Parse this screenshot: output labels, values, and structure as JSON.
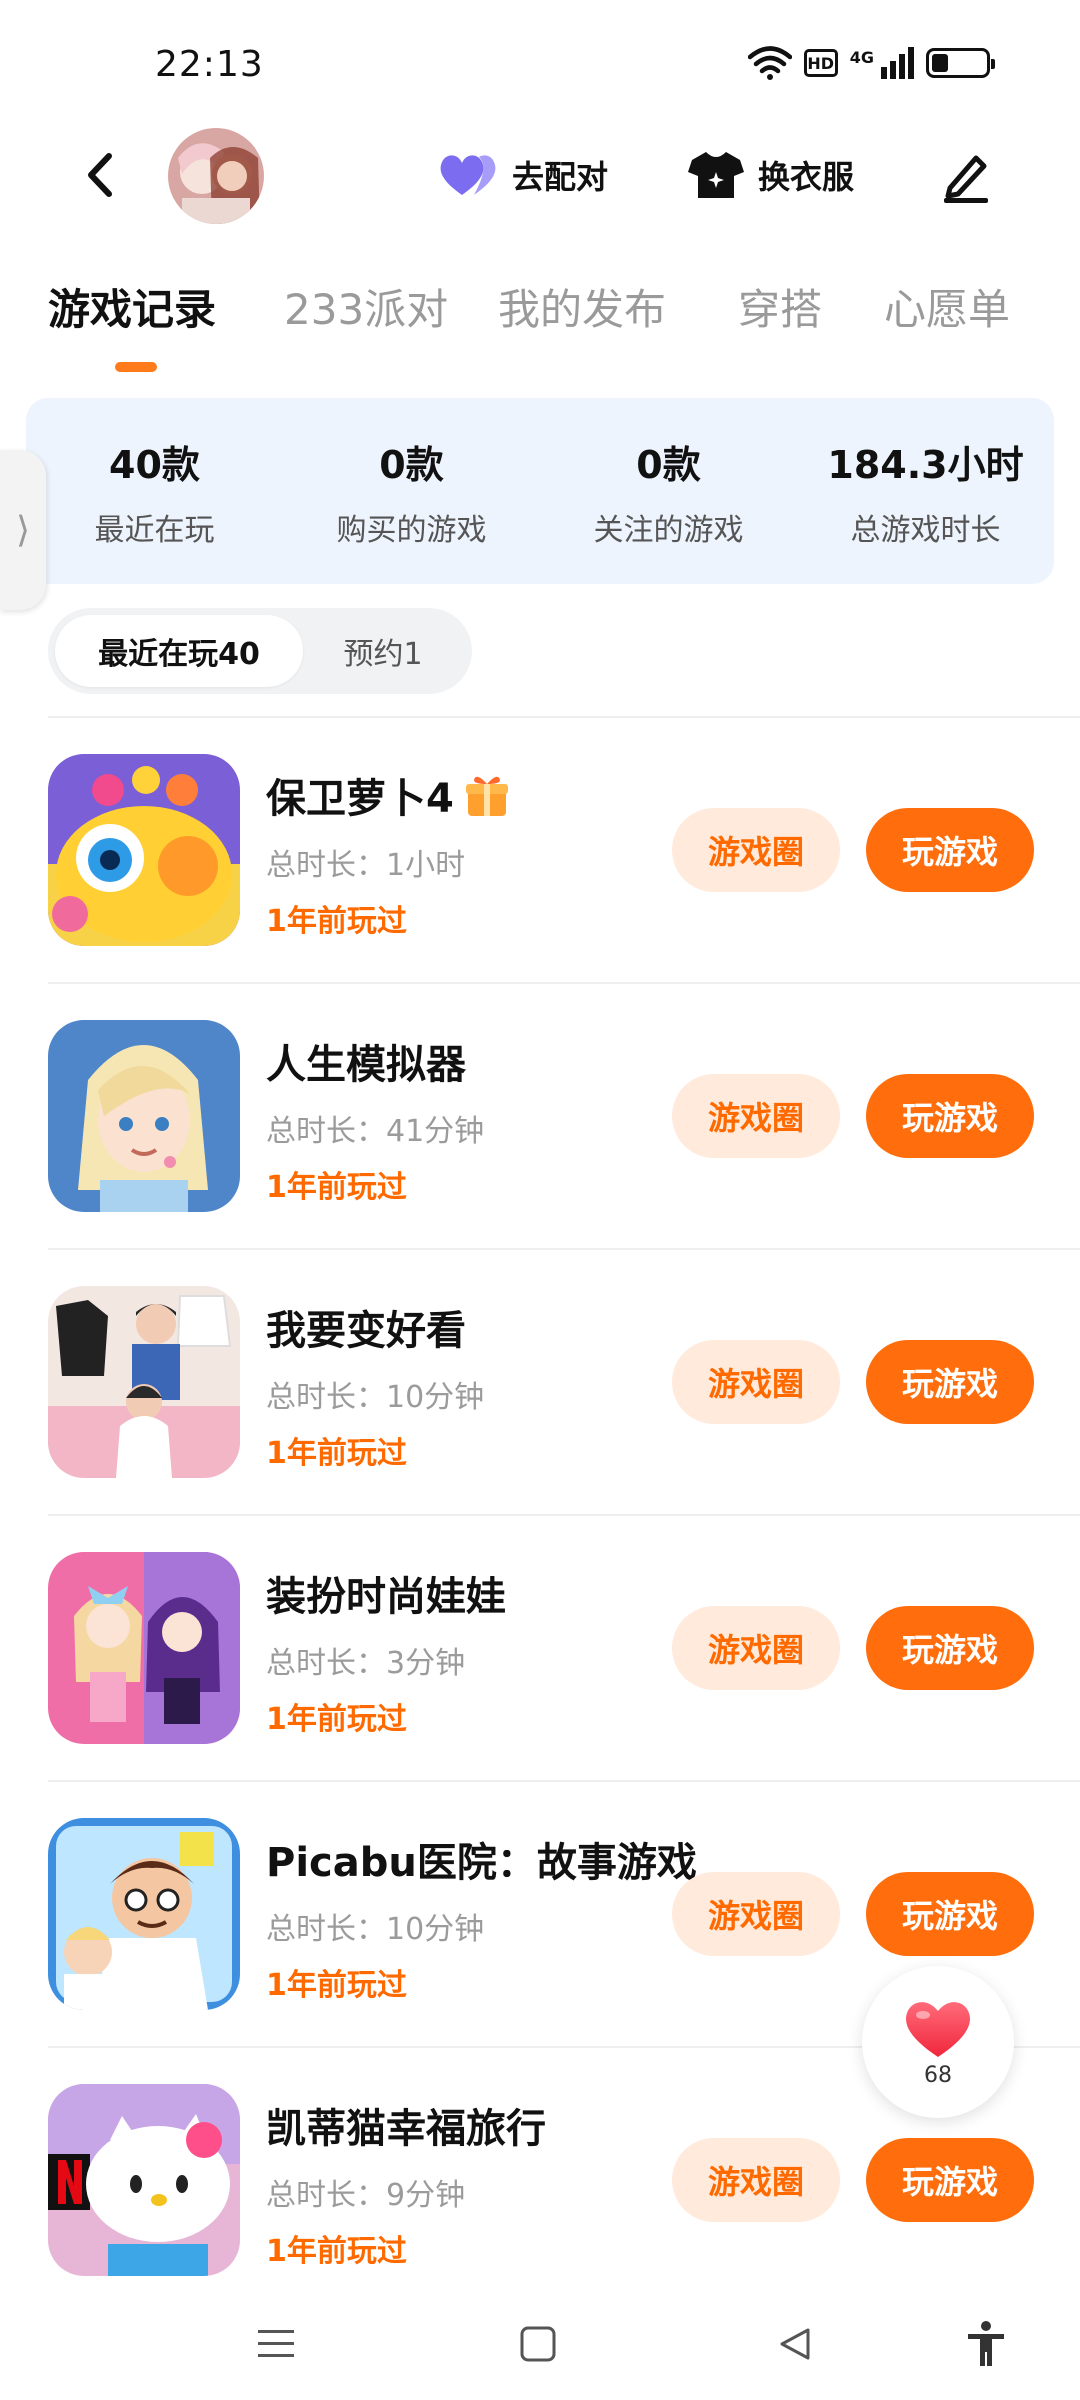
{
  "status_bar": {
    "time": "22:13",
    "hd_label": "HD",
    "network_label": "4G",
    "battery_level": 0.3
  },
  "top_bar": {
    "match_label": "去配对",
    "outfit_label": "换衣服"
  },
  "tabs": [
    {
      "label": "游戏记录",
      "active": true
    },
    {
      "label": "233派对",
      "active": false
    },
    {
      "label": "我的发布",
      "active": false
    },
    {
      "label": "穿搭",
      "active": false
    },
    {
      "label": "心愿单",
      "active": false
    }
  ],
  "stats": [
    {
      "value": "40款",
      "label": "最近在玩"
    },
    {
      "value": "0款",
      "label": "购买的游戏"
    },
    {
      "value": "0款",
      "label": "关注的游戏"
    },
    {
      "value": "184.3小时",
      "label": "总游戏时长"
    }
  ],
  "side_handle": {
    "glyph": "⟩"
  },
  "filters": {
    "recent": "最近在玩40",
    "reserved": "预约1"
  },
  "games": [
    {
      "title": "保卫萝卜4",
      "duration": "总时长：1小时",
      "last_played": "1年前玩过",
      "circle_label": "游戏圈",
      "play_label": "玩游戏",
      "has_gift": true
    },
    {
      "title": "人生模拟器",
      "duration": "总时长：41分钟",
      "last_played": "1年前玩过",
      "circle_label": "游戏圈",
      "play_label": "玩游戏",
      "has_gift": false
    },
    {
      "title": "我要变好看",
      "duration": "总时长：10分钟",
      "last_played": "1年前玩过",
      "circle_label": "游戏圈",
      "play_label": "玩游戏",
      "has_gift": false
    },
    {
      "title": "装扮时尚娃娃",
      "duration": "总时长：3分钟",
      "last_played": "1年前玩过",
      "circle_label": "游戏圈",
      "play_label": "玩游戏",
      "has_gift": false
    },
    {
      "title": "Picabu医院：故事游戏",
      "duration": "总时长：10分钟",
      "last_played": "1年前玩过",
      "circle_label": "游戏圈",
      "play_label": "玩游戏",
      "has_gift": false
    },
    {
      "title": "凯蒂猫幸福旅行",
      "duration": "总时长：9分钟",
      "last_played": "1年前玩过",
      "circle_label": "游戏圈",
      "play_label": "玩游戏",
      "has_gift": false
    }
  ],
  "like_float": {
    "count": "68"
  },
  "colors": {
    "accent": "#ff6d0c",
    "accent_light": "#ffeadb",
    "stats_bg": "#eef4fd",
    "heart": "#7b6cf0"
  },
  "icons": {
    "back": "back-arrow-icon",
    "match": "heart-icon",
    "outfit": "tshirt-icon",
    "edit": "edit-pen-icon",
    "like": "like-heart-icon",
    "nav": [
      "menu-icon",
      "home-square-icon",
      "back-triangle-icon",
      "accessibility-icon"
    ]
  }
}
